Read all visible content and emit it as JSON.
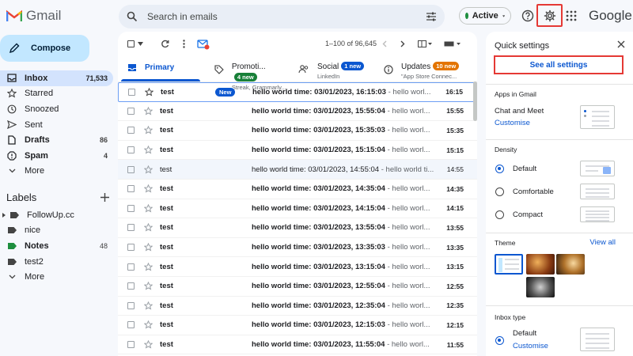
{
  "brand": {
    "app_name": "Gmail",
    "google_word": "Google"
  },
  "search": {
    "placeholder": "Search in emails"
  },
  "status": {
    "label": "Active",
    "color": "#1e8e3e"
  },
  "compose": {
    "label": "Compose"
  },
  "nav": [
    {
      "label": "Inbox",
      "count": "71,533",
      "icon": "inbox-icon"
    },
    {
      "label": "Starred",
      "count": "",
      "icon": "star-icon"
    },
    {
      "label": "Snoozed",
      "count": "",
      "icon": "clock-icon"
    },
    {
      "label": "Sent",
      "count": "",
      "icon": "send-icon"
    },
    {
      "label": "Drafts",
      "count": "86",
      "icon": "draft-icon"
    },
    {
      "label": "Spam",
      "count": "4",
      "icon": "spam-icon"
    },
    {
      "label": "More",
      "count": "",
      "icon": "chevron-down-icon"
    }
  ],
  "labels_section": {
    "title": "Labels",
    "items": [
      {
        "label": "FollowUp.cc",
        "count": ""
      },
      {
        "label": "nice",
        "count": ""
      },
      {
        "label": "Notes",
        "count": "48"
      },
      {
        "label": "test2",
        "count": ""
      },
      {
        "label": "More",
        "count": ""
      }
    ]
  },
  "toolbar": {
    "range": "1–100 of 96,645"
  },
  "tabs": [
    {
      "name": "Primary",
      "sub": "",
      "badge": ""
    },
    {
      "name": "Promoti...",
      "sub": "Streak, Grammarly....",
      "badge": "4 new",
      "badge_color": "#188038"
    },
    {
      "name": "Social",
      "sub": "LinkedIn",
      "badge": "1 new",
      "badge_color": "#0b57d0"
    },
    {
      "name": "Updates",
      "sub": "\"App Store Connec...",
      "badge": "10 new",
      "badge_color": "#e37400"
    }
  ],
  "emails": [
    {
      "sender": "test",
      "badge": "New",
      "subject": "hello world time: 03/01/2023, 16:15:03",
      "snippet": " - hello worl...",
      "time": "16:15",
      "read": false
    },
    {
      "sender": "test",
      "badge": "",
      "subject": "hello world time: 03/01/2023, 15:55:04",
      "snippet": " - hello worl...",
      "time": "15:55",
      "read": false
    },
    {
      "sender": "test",
      "badge": "",
      "subject": "hello world time: 03/01/2023, 15:35:03",
      "snippet": " - hello worl...",
      "time": "15:35",
      "read": false
    },
    {
      "sender": "test",
      "badge": "",
      "subject": "hello world time: 03/01/2023, 15:15:04",
      "snippet": " - hello worl...",
      "time": "15:15",
      "read": false
    },
    {
      "sender": "test",
      "badge": "",
      "subject": "hello world time: 03/01/2023, 14:55:04",
      "snippet": " - hello world ti...",
      "time": "14:55",
      "read": true
    },
    {
      "sender": "test",
      "badge": "",
      "subject": "hello world time: 03/01/2023, 14:35:04",
      "snippet": " - hello worl...",
      "time": "14:35",
      "read": false
    },
    {
      "sender": "test",
      "badge": "",
      "subject": "hello world time: 03/01/2023, 14:15:04",
      "snippet": " - hello worl...",
      "time": "14:15",
      "read": false
    },
    {
      "sender": "test",
      "badge": "",
      "subject": "hello world time: 03/01/2023, 13:55:04",
      "snippet": " - hello worl...",
      "time": "13:55",
      "read": false
    },
    {
      "sender": "test",
      "badge": "",
      "subject": "hello world time: 03/01/2023, 13:35:03",
      "snippet": " - hello worl...",
      "time": "13:35",
      "read": false
    },
    {
      "sender": "test",
      "badge": "",
      "subject": "hello world time: 03/01/2023, 13:15:04",
      "snippet": " - hello worl...",
      "time": "13:15",
      "read": false
    },
    {
      "sender": "test",
      "badge": "",
      "subject": "hello world time: 03/01/2023, 12:55:04",
      "snippet": " - hello worl...",
      "time": "12:55",
      "read": false
    },
    {
      "sender": "test",
      "badge": "",
      "subject": "hello world time: 03/01/2023, 12:35:04",
      "snippet": " - hello worl...",
      "time": "12:35",
      "read": false
    },
    {
      "sender": "test",
      "badge": "",
      "subject": "hello world time: 03/01/2023, 12:15:03",
      "snippet": " - hello worl...",
      "time": "12:15",
      "read": false
    },
    {
      "sender": "test",
      "badge": "",
      "subject": "hello world time: 03/01/2023, 11:55:04",
      "snippet": " - hello worl...",
      "time": "11:55",
      "read": false
    }
  ],
  "quick_settings": {
    "title": "Quick settings",
    "see_all": "See all settings",
    "apps_title": "Apps in Gmail",
    "chat_meet": "Chat and Meet",
    "customise": "Customise",
    "density_title": "Density",
    "density_options": [
      "Default",
      "Comfortable",
      "Compact"
    ],
    "density_selected": "Default",
    "theme_title": "Theme",
    "view_all": "View all",
    "inbox_type_title": "Inbox type",
    "inbox_default": "Default",
    "inbox_customise": "Customise"
  },
  "colors": {
    "accent": "#0b57d0",
    "highlight": "#e53935",
    "selected_nav": "#d3e3fd",
    "compose_bg": "#c2e7ff"
  }
}
